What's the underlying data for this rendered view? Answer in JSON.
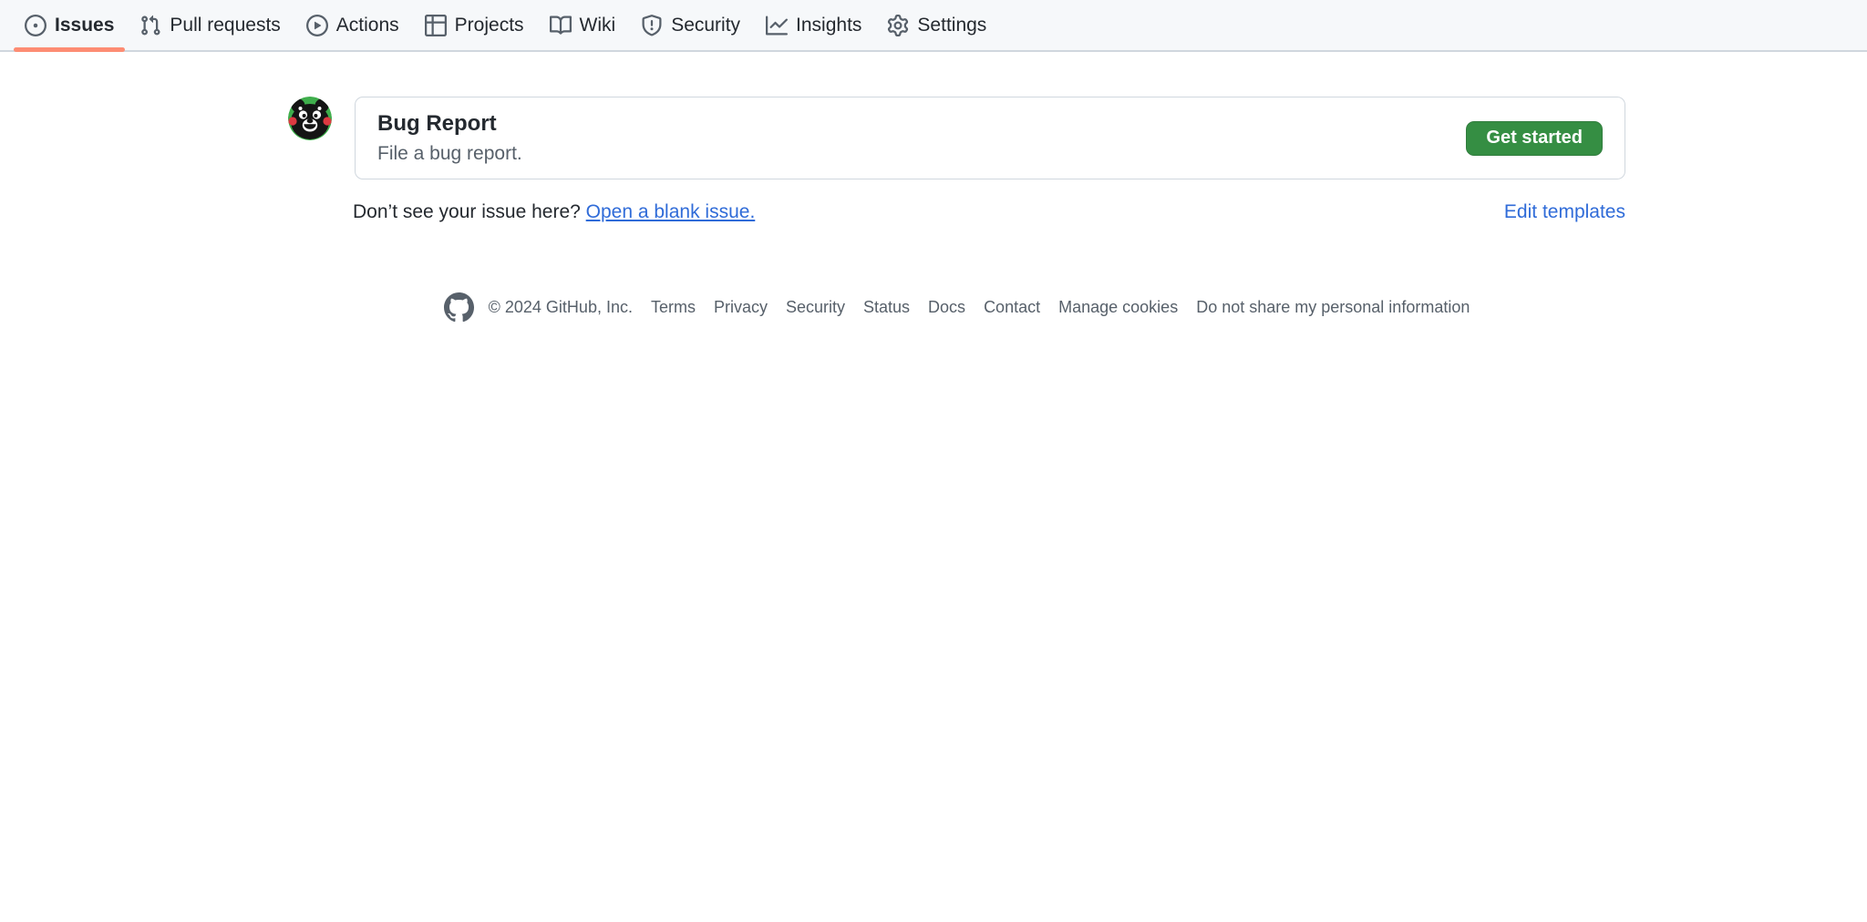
{
  "nav": {
    "tabs": [
      {
        "label": "Issues",
        "icon": "issue-opened-icon",
        "active": true
      },
      {
        "label": "Pull requests",
        "icon": "git-pull-request-icon",
        "active": false
      },
      {
        "label": "Actions",
        "icon": "play-icon",
        "active": false
      },
      {
        "label": "Projects",
        "icon": "table-icon",
        "active": false
      },
      {
        "label": "Wiki",
        "icon": "book-icon",
        "active": false
      },
      {
        "label": "Security",
        "icon": "shield-icon",
        "active": false
      },
      {
        "label": "Insights",
        "icon": "graph-icon",
        "active": false
      },
      {
        "label": "Settings",
        "icon": "gear-icon",
        "active": false
      }
    ]
  },
  "template": {
    "title": "Bug Report",
    "description": "File a bug report.",
    "button_label": "Get started",
    "avatar": "kumamon-avatar"
  },
  "blank_issue": {
    "prompt": "Don’t see your issue here?",
    "link_label": "Open a blank issue.",
    "edit_label": "Edit templates"
  },
  "footer": {
    "copyright": "© 2024 GitHub, Inc.",
    "links": [
      "Terms",
      "Privacy",
      "Security",
      "Status",
      "Docs",
      "Contact",
      "Manage cookies",
      "Do not share my personal information"
    ]
  },
  "colors": {
    "accent_green": "#358e43",
    "link_blue": "#2f6bd8",
    "active_tab_underline": "#fd8c73",
    "border": "#d0d7de",
    "text_primary": "#24292f",
    "text_secondary": "#57606a",
    "nav_background": "#f6f8fa",
    "page_background": "#ffffff"
  }
}
